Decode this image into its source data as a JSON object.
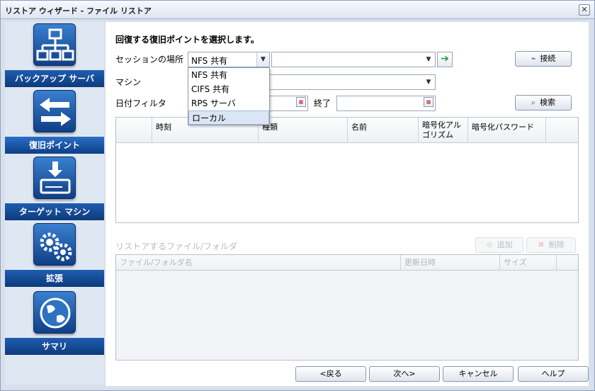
{
  "window": {
    "title": "リストア ウィザード - ファイル リストア",
    "close": "✕"
  },
  "sidebar": {
    "items": [
      {
        "label": "バックアップ サーバ"
      },
      {
        "label": "復旧ポイント"
      },
      {
        "label": "ターゲット マシン"
      },
      {
        "label": "拡張"
      },
      {
        "label": "サマリ"
      }
    ]
  },
  "main": {
    "heading": "回復する復旧ポイントを選択します。",
    "session_label": "セッションの場所",
    "session_value": "NFS 共有",
    "path_value": "",
    "machine_label": "マシン",
    "date_filter_label": "日付フィルタ",
    "end_label": "終了",
    "connect_button": "接続",
    "search_button": "検索",
    "dropdown_options": [
      "NFS 共有",
      "CIFS 共有",
      "RPS サーバ",
      "ローカル"
    ],
    "recovery_columns": [
      "時刻",
      "種類",
      "名前",
      "暗号化アル ゴリズム",
      "暗号化パスワード"
    ],
    "files_section_label": "リストアするファイル/フォルダ",
    "add_button": "追加",
    "remove_button": "削除",
    "files_columns": [
      "ファイル/フォルダ名",
      "更新日時",
      "サイズ"
    ]
  },
  "footer": {
    "back": "<戻る",
    "next": "次へ>",
    "cancel": "キャンセル",
    "help": "ヘルプ"
  }
}
